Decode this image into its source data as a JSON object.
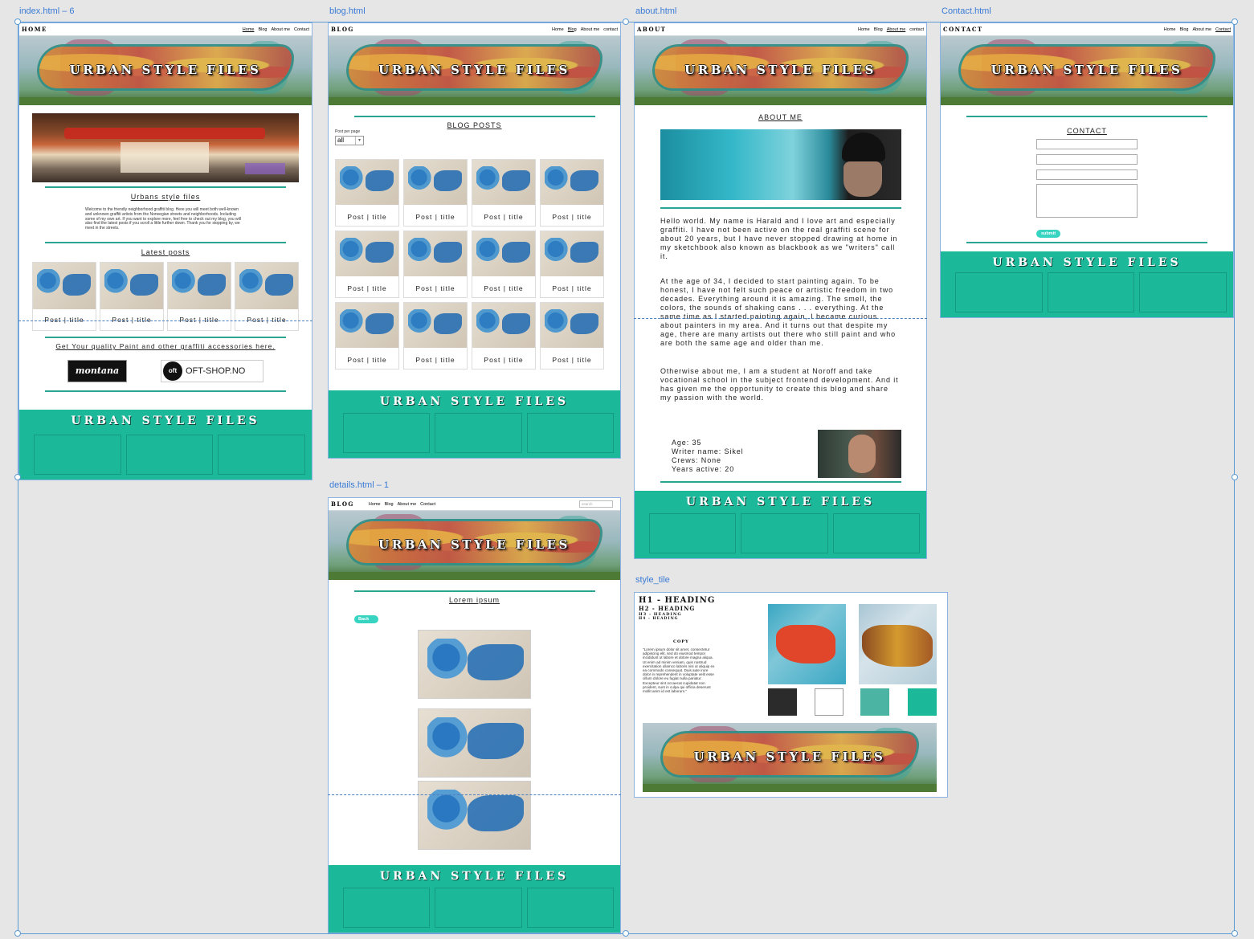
{
  "artboards": {
    "index": "index.html – 6",
    "blog": "blog.html",
    "about": "about.html",
    "contact": "Contact.html",
    "details": "details.html – 1",
    "style": "style_tile"
  },
  "site": {
    "hero_title": "URBAN STYLE FILES",
    "footer_title": "URBAN STYLE FILES",
    "nav": {
      "home": "Home",
      "blog": "Blog",
      "about": "About me",
      "contact": "Contact",
      "contact_lower": "contact"
    },
    "search_placeholder": "search"
  },
  "index_page": {
    "brand": "HOME",
    "heading": "Urbans style files",
    "intro": "Welcome to the friendly neighborhood graffiti blog. Here you will meet both well-known and unknown graffiti artists from the Norwegian streets and neighborhoods. Including some of my own art. If you want to explore more, feel free to check out my blog, you will also find the latest posts if you scroll a little further down. Thank you for stopping by, we meet in the streets.",
    "latest_heading": "Latest posts",
    "post_caption": "Post | title",
    "shop_link": "Get Your quality Paint and other graffiti accessories here.",
    "sponsor1": "montana",
    "sponsor2_mark": "oft",
    "sponsor2": "OFT-SHOP.NO"
  },
  "blog_page": {
    "brand": "BLOG",
    "heading": "BLOG POSTS",
    "per_page_label": "Post per page",
    "per_page_value": "all",
    "post_caption": "Post | title"
  },
  "about_page": {
    "brand": "ABOUT",
    "heading": "ABOUT ME",
    "p1": "Hello world. My name is Harald and I love art and especially graffiti. I have not been active on the real graffiti scene for about 20 years, but I have never stopped drawing at home in my sketchbook also known as blackbook as we \"writers\" call it.",
    "p2": "At the age of 34, I decided to start painting again. To be honest, I have not felt such peace or artistic freedom in two decades. Everything around it is amazing. The smell, the colors, the sounds of shaking cans . . . everything. At the same time as I started painting again, I became curious about painters in my area. And it turns out that despite my age, there are many artists out there who still paint and who are both the same age and older than me.",
    "p3": "Otherwise about me, I am a student at Noroff and take vocational school in the subject frontend development. And it has given me the opportunity to create this blog and share my passion with the world.",
    "age": "Age: 35",
    "writer": "Writer name: Sikel",
    "crews": "Crews: None",
    "years": "Years active: 20"
  },
  "contact_page": {
    "brand": "CONTACT",
    "heading": "CONTACT",
    "submit": "submit"
  },
  "details_page": {
    "brand": "BLOG",
    "heading": "Lorem ipsum",
    "back": "Back"
  },
  "style_tile": {
    "h1": "H1 - HEADING",
    "h2": "H2 - HEADING",
    "h3": "H3 - HEADING",
    "h4": "H4 - HEADING",
    "copy_label": "COPY",
    "copy_text": "\"Lorem ipsum dolor sit amet, consectetur adipiscing elit, sed do eiusmod tempor incididunt ut labore et dolore magna aliqua. Ut enim ad minim veniam, quis nostrud exercitation ullamco laboris nisi ut aliquip ex ea commodo consequat. Duis aute irure dolor in reprehenderit in voluptate velit esse cillum dolore eu fugiat nulla pariatur. Excepteur sint occaecat cupidatat non proident, sunt in culpa qui officia deserunt mollit anim id est laborum.\"",
    "swatches": [
      "#2b2b2b",
      "#ffffff",
      "#4cb4a2",
      "#1bb89a"
    ]
  },
  "colors": {
    "accent": "#1bb89a",
    "rule": "#2aa493",
    "button": "#36d4c1",
    "selection": "#5b9bd5"
  }
}
